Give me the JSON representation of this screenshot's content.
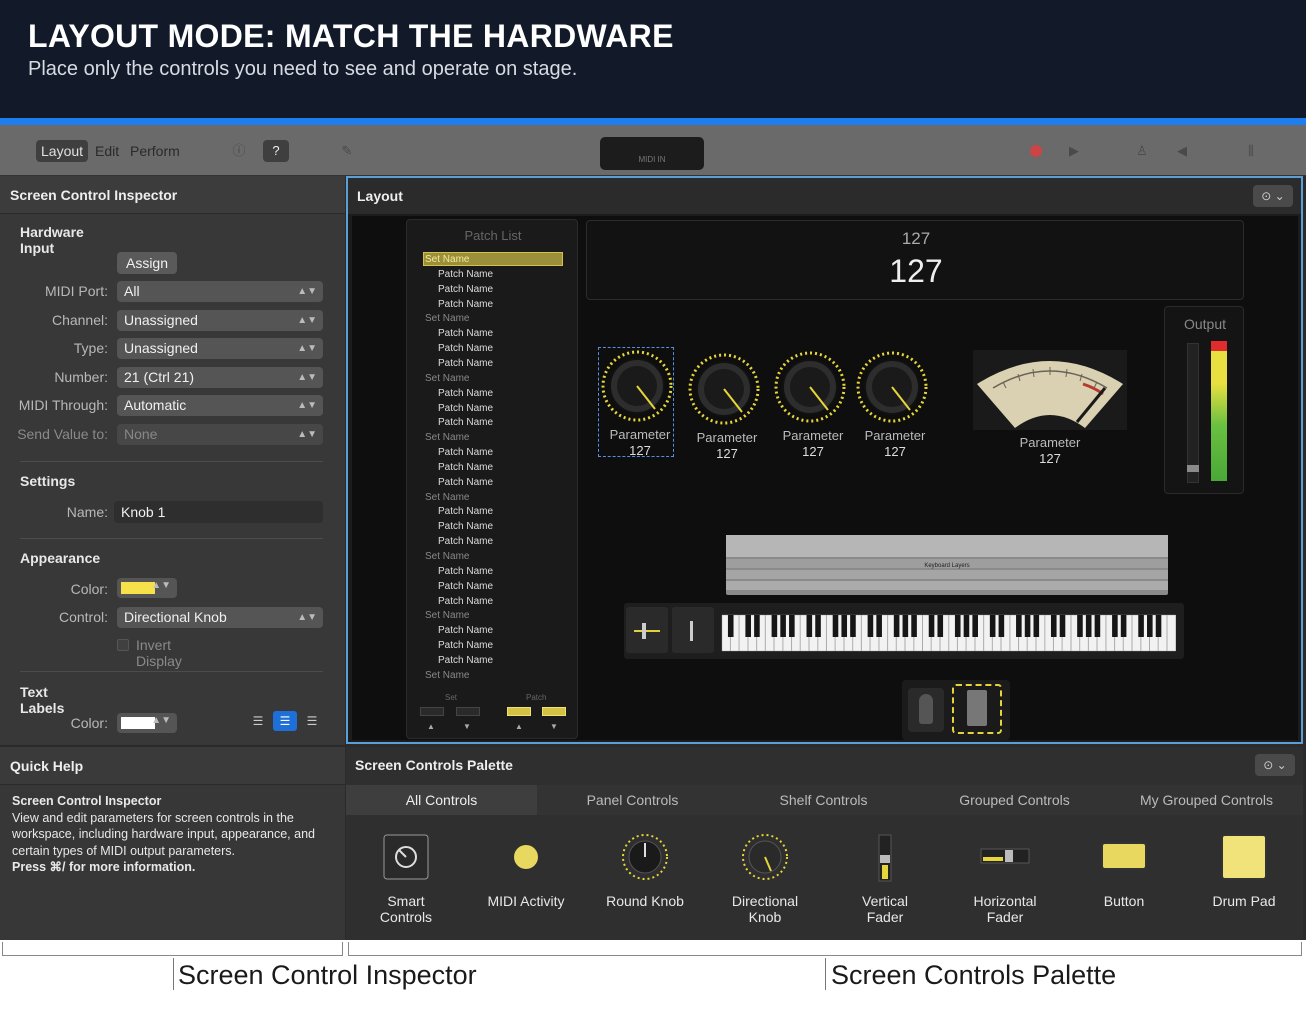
{
  "banner": {
    "title": "LAYOUT MODE: MATCH THE HARDWARE",
    "subtitle": "Place only the controls you need to see and operate on stage."
  },
  "toolbar": {
    "modes": [
      "Layout",
      "Edit",
      "Perform"
    ],
    "midi_in": "MIDI IN"
  },
  "inspector": {
    "title": "Screen Control Inspector",
    "hardware_input": {
      "heading": "Hardware Input",
      "assign_label": "Assign",
      "midi_port_label": "MIDI Port:",
      "midi_port_value": "All",
      "channel_label": "Channel:",
      "channel_value": "Unassigned",
      "type_label": "Type:",
      "type_value": "Unassigned",
      "number_label": "Number:",
      "number_value": "21 (Ctrl 21)",
      "midi_through_label": "MIDI Through:",
      "midi_through_value": "Automatic",
      "send_value_label": "Send Value to:",
      "send_value_value": "None"
    },
    "settings": {
      "heading": "Settings",
      "name_label": "Name:",
      "name_value": "Knob 1"
    },
    "appearance": {
      "heading": "Appearance",
      "color_label": "Color:",
      "color_value": "#f6e14a",
      "control_label": "Control:",
      "control_value": "Directional Knob",
      "invert_label": "Invert Display"
    },
    "text_labels": {
      "heading": "Text Labels",
      "color_label": "Color:",
      "color_value": "#ffffff"
    }
  },
  "quick_help": {
    "title": "Quick Help",
    "heading": "Screen Control Inspector",
    "body": "View and edit parameters for screen controls in the workspace, including hardware input, appearance, and certain types of MIDI output parameters.",
    "shortcut": "Press ⌘/ for more information."
  },
  "layout": {
    "title": "Layout",
    "patch_list": {
      "title": "Patch List",
      "items": [
        {
          "text": "Set Name",
          "set": true,
          "selected": true
        },
        {
          "text": "Patch Name",
          "set": false
        },
        {
          "text": "Patch Name",
          "set": false
        },
        {
          "text": "Patch Name",
          "set": false
        },
        {
          "text": "Set Name",
          "set": true
        },
        {
          "text": "Patch Name",
          "set": false
        },
        {
          "text": "Patch Name",
          "set": false
        },
        {
          "text": "Patch Name",
          "set": false
        },
        {
          "text": "Set Name",
          "set": true
        },
        {
          "text": "Patch Name",
          "set": false
        },
        {
          "text": "Patch Name",
          "set": false
        },
        {
          "text": "Patch Name",
          "set": false
        },
        {
          "text": "Set Name",
          "set": true
        },
        {
          "text": "Patch Name",
          "set": false
        },
        {
          "text": "Patch Name",
          "set": false
        },
        {
          "text": "Patch Name",
          "set": false
        },
        {
          "text": "Set Name",
          "set": true
        },
        {
          "text": "Patch Name",
          "set": false
        },
        {
          "text": "Patch Name",
          "set": false
        },
        {
          "text": "Patch Name",
          "set": false
        },
        {
          "text": "Set Name",
          "set": true
        },
        {
          "text": "Patch Name",
          "set": false
        },
        {
          "text": "Patch Name",
          "set": false
        },
        {
          "text": "Patch Name",
          "set": false
        },
        {
          "text": "Set Name",
          "set": true
        },
        {
          "text": "Patch Name",
          "set": false
        },
        {
          "text": "Patch Name",
          "set": false
        },
        {
          "text": "Patch Name",
          "set": false
        },
        {
          "text": "Set Name",
          "set": true
        }
      ],
      "set_label": "Set",
      "patch_label": "Patch"
    },
    "display": {
      "line1": "127",
      "line2": "127"
    },
    "knobs": [
      {
        "label": "Parameter",
        "value": "127"
      },
      {
        "label": "Parameter",
        "value": "127"
      },
      {
        "label": "Parameter",
        "value": "127"
      },
      {
        "label": "Parameter",
        "value": "127"
      }
    ],
    "meter": {
      "label": "Parameter",
      "value": "127"
    },
    "output": {
      "title": "Output"
    },
    "keyboard_layers_label": "Keyboard Layers"
  },
  "palette": {
    "title": "Screen Controls Palette",
    "tabs": [
      "All Controls",
      "Panel Controls",
      "Shelf Controls",
      "Grouped Controls",
      "My Grouped Controls"
    ],
    "items": [
      {
        "name": "Smart\nControls",
        "icon": "smart-controls-icon"
      },
      {
        "name": "MIDI Activity",
        "icon": "midi-activity-icon"
      },
      {
        "name": "Round Knob",
        "icon": "round-knob-icon"
      },
      {
        "name": "Directional\nKnob",
        "icon": "directional-knob-icon"
      },
      {
        "name": "Vertical\nFader",
        "icon": "vertical-fader-icon"
      },
      {
        "name": "Horizontal\nFader",
        "icon": "horizontal-fader-icon"
      },
      {
        "name": "Button",
        "icon": "button-icon"
      },
      {
        "name": "Drum Pad",
        "icon": "drum-pad-icon"
      }
    ]
  },
  "callouts": {
    "inspector": "Screen Control Inspector",
    "palette": "Screen Controls Palette"
  }
}
